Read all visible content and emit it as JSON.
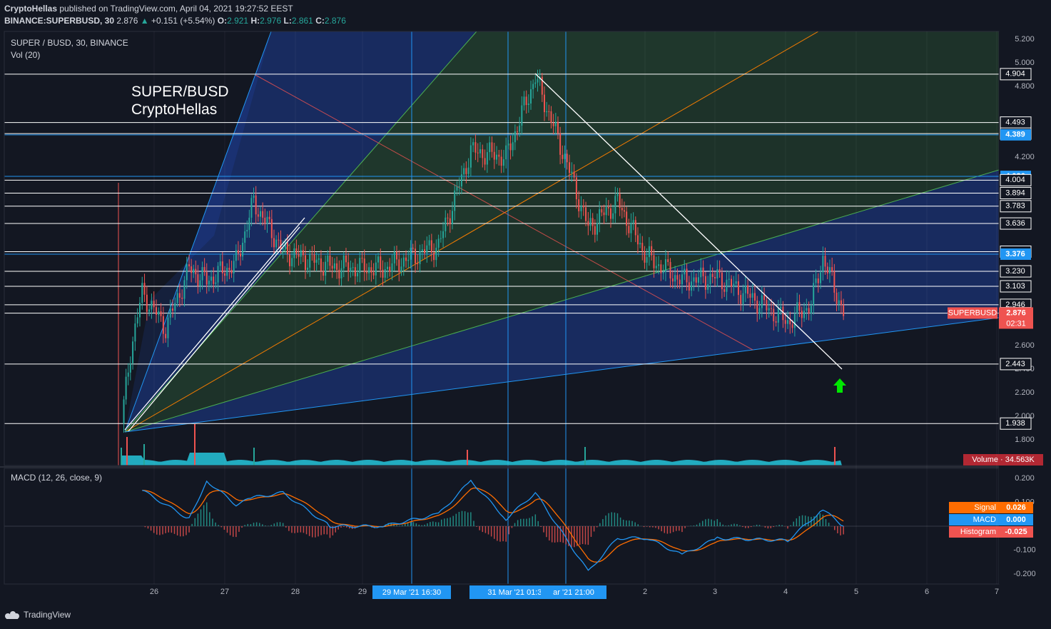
{
  "header": {
    "publisher": "CryptoHellas",
    "published_text": "published on TradingView.com, April 04, 2021 19:27:52 EEST",
    "symbol": "BINANCE:SUPERBUSD, 30",
    "last": "2.876",
    "change": "+0.151 (+5.54%)",
    "o_label": "O:",
    "o": "2.921",
    "h_label": "H:",
    "h": "2.976",
    "l_label": "L:",
    "l": "2.861",
    "c_label": "C:",
    "c": "2.876"
  },
  "pane_legend": {
    "title": "SUPER / BUSD, 30, BINANCE",
    "vol": "Vol (20)",
    "macd": "MACD (12, 26, close, 9)"
  },
  "watermark": {
    "line1": "SUPER/BUSD",
    "line2": "CryptoHellas"
  },
  "footer": {
    "brand": "TradingView"
  },
  "colors": {
    "bg": "#131722",
    "up": "#26a69a",
    "down": "#ef5350",
    "volume": "#26c6da",
    "fan_blue": "#2962ff",
    "fan_green": "#4caf50",
    "fan_orange": "#f57c00",
    "macd": "#2196f3",
    "signal": "#ff6d00",
    "arrow": "#00e600"
  },
  "chart_data": [
    {
      "type": "candlestick",
      "title": "SUPER / BUSD, 30, BINANCE",
      "x_ticks": [
        "26",
        "27",
        "28",
        "29",
        "2",
        "3",
        "4",
        "5",
        "6",
        "7"
      ],
      "x_time_labels": [
        "29 Mar '21   16:30",
        "31 Mar '21   01:30",
        "ar '21   21:00"
      ],
      "y_ticks": [
        "5.200",
        "5.000",
        "4.800",
        "4.200",
        "2.600",
        "2.400",
        "2.200",
        "2.000",
        "1.800"
      ],
      "price_levels": [
        {
          "label": "4.904",
          "value": 4.904
        },
        {
          "label": "4.493",
          "value": 4.493
        },
        {
          "label": "4.399",
          "value": 4.399
        },
        {
          "label": "4.389",
          "value": 4.389,
          "highlight": "blue"
        },
        {
          "label": "4.036",
          "value": 4.036,
          "highlight": "blue"
        },
        {
          "label": "4.004",
          "value": 4.004
        },
        {
          "label": "3.894",
          "value": 3.894
        },
        {
          "label": "3.783",
          "value": 3.783
        },
        {
          "label": "3.636",
          "value": 3.636
        },
        {
          "label": "3.397",
          "value": 3.397
        },
        {
          "label": "3.376",
          "value": 3.376,
          "highlight": "blue"
        },
        {
          "label": "3.230",
          "value": 3.23
        },
        {
          "label": "3.103",
          "value": 3.103
        },
        {
          "label": "2.946",
          "value": 2.946
        },
        {
          "label": "2.875",
          "value": 2.875
        },
        {
          "label": "2.443",
          "value": 2.443
        },
        {
          "label": "1.938",
          "value": 1.938
        }
      ],
      "last_price": {
        "symbol": "SUPERBUSD",
        "value": "2.876",
        "countdown": "02:31"
      },
      "volume_label": {
        "name": "Volume",
        "value": "34.563K"
      },
      "price_path": [
        {
          "x": "Mar 25 13:00",
          "y": 1.94
        },
        {
          "x": "Mar 25 16:00",
          "y": 2.55
        },
        {
          "x": "Mar 25 20:00",
          "y": 3.05
        },
        {
          "x": "Mar 26 04:00",
          "y": 2.75
        },
        {
          "x": "Mar 26 12:00",
          "y": 3.25
        },
        {
          "x": "Mar 26 18:00",
          "y": 3.15
        },
        {
          "x": "Mar 27 04:00",
          "y": 3.3
        },
        {
          "x": "Mar 27 10:00",
          "y": 3.82
        },
        {
          "x": "Mar 27 20:00",
          "y": 3.4
        },
        {
          "x": "Mar 28 12:00",
          "y": 3.27
        },
        {
          "x": "Mar 29 06:00",
          "y": 3.25
        },
        {
          "x": "Mar 30 01:00",
          "y": 3.45
        },
        {
          "x": "Mar 30 12:00",
          "y": 4.25
        },
        {
          "x": "Mar 31 00:00",
          "y": 4.2
        },
        {
          "x": "Mar 31 10:00",
          "y": 4.88
        },
        {
          "x": "Mar 31 20:00",
          "y": 4.2
        },
        {
          "x": "Apr 01 04:00",
          "y": 3.6
        },
        {
          "x": "Apr 01 14:00",
          "y": 3.82
        },
        {
          "x": "Apr 02 00:00",
          "y": 3.35
        },
        {
          "x": "Apr 02 12:00",
          "y": 3.15
        },
        {
          "x": "Apr 03 00:00",
          "y": 3.18
        },
        {
          "x": "Apr 03 12:00",
          "y": 3.0
        },
        {
          "x": "Apr 04 00:00",
          "y": 2.8
        },
        {
          "x": "Apr 04 08:00",
          "y": 2.95
        },
        {
          "x": "Apr 04 12:00",
          "y": 3.35
        },
        {
          "x": "Apr 04 19:00",
          "y": 2.88
        }
      ]
    },
    {
      "type": "line",
      "title": "MACD (12, 26, close, 9)",
      "y_ticks": [
        "0.200",
        "0.100",
        "-0.100",
        "-0.200"
      ],
      "series": [
        {
          "name": "Signal",
          "value": "0.026",
          "color": "#ff6d00"
        },
        {
          "name": "MACD",
          "value": "0.000",
          "color": "#2196f3"
        },
        {
          "name": "Histogram",
          "value": "-0.025",
          "color": "#ef5350"
        }
      ],
      "macd_path": [
        {
          "x": "Mar 25 20:00",
          "y": 0.15
        },
        {
          "x": "Mar 26 12:00",
          "y": 0.03
        },
        {
          "x": "Mar 26 18:00",
          "y": 0.19
        },
        {
          "x": "Mar 27 04:00",
          "y": 0.09
        },
        {
          "x": "Mar 27 10:00",
          "y": 0.12
        },
        {
          "x": "Mar 27 20:00",
          "y": 0.14
        },
        {
          "x": "Mar 28 12:00",
          "y": 0.0
        },
        {
          "x": "Mar 29 06:00",
          "y": 0.0
        },
        {
          "x": "Mar 30 01:00",
          "y": 0.05
        },
        {
          "x": "Mar 30 12:00",
          "y": 0.19
        },
        {
          "x": "Mar 31 00:00",
          "y": 0.03
        },
        {
          "x": "Mar 31 10:00",
          "y": 0.14
        },
        {
          "x": "Apr 01 04:00",
          "y": -0.19
        },
        {
          "x": "Apr 01 14:00",
          "y": -0.05
        },
        {
          "x": "Apr 02 00:00",
          "y": -0.05
        },
        {
          "x": "Apr 02 12:00",
          "y": -0.12
        },
        {
          "x": "Apr 03 00:00",
          "y": -0.05
        },
        {
          "x": "Apr 04 00:00",
          "y": -0.06
        },
        {
          "x": "Apr 04 12:00",
          "y": 0.07
        },
        {
          "x": "Apr 04 19:00",
          "y": 0.0
        }
      ]
    }
  ]
}
